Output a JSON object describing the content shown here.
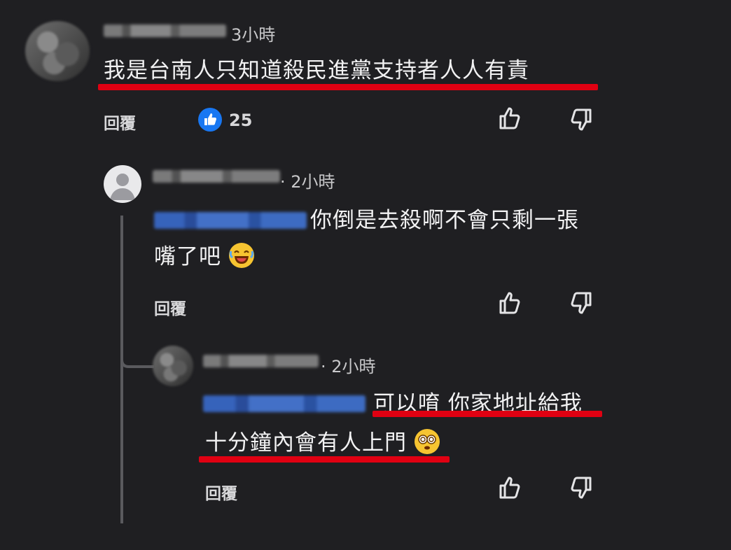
{
  "comments": [
    {
      "time": "3小時",
      "text": "我是台南人只知道殺民進黨支持者人人有責",
      "reply_label": "回覆",
      "likes": "25"
    },
    {
      "time": "· 2小時",
      "text_line1": "你倒是去殺啊不會只剩一張",
      "text_line2": "嘴了吧",
      "reply_label": "回覆"
    },
    {
      "time": "· 2小時",
      "text_line1": "可以唷 你家地址給我",
      "text_line2": "十分鐘內會有人上門",
      "reply_label": "回覆"
    }
  ],
  "colors": {
    "background": "#1f1f22",
    "highlight": "#e00012",
    "like_blue": "#1877f2"
  },
  "icons": [
    "like-reaction-icon",
    "thumbs-up-icon",
    "thumbs-down-icon",
    "laughing-emoji-icon",
    "dizzy-emoji-icon",
    "default-avatar-icon"
  ]
}
